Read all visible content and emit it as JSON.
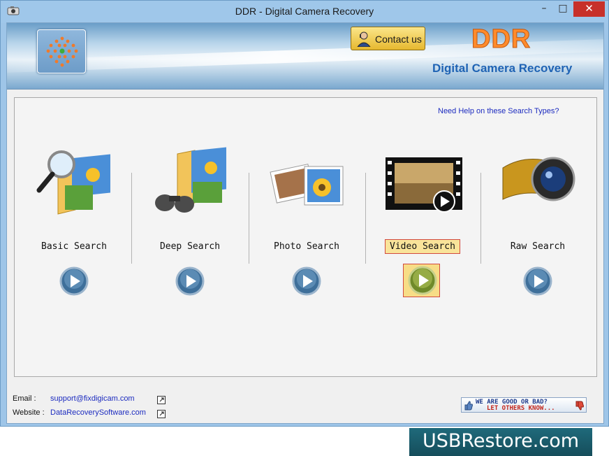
{
  "window": {
    "title": "DDR - Digital Camera Recovery",
    "minimize": "–",
    "maximize": "□",
    "close": "✕"
  },
  "header": {
    "contact_label": "Contact us",
    "brand": "DDR",
    "subtitle": "Digital Camera Recovery"
  },
  "panel": {
    "help_link": "Need Help on these Search Types?",
    "options": [
      {
        "label": "Basic Search",
        "icon": "magnifier-folder-icon",
        "selected": false
      },
      {
        "label": "Deep Search",
        "icon": "binoculars-folder-icon",
        "selected": false
      },
      {
        "label": "Photo Search",
        "icon": "photos-stack-icon",
        "selected": false
      },
      {
        "label": "Video Search",
        "icon": "film-strip-icon",
        "selected": true
      },
      {
        "label": "Raw Search",
        "icon": "camera-lens-film-icon",
        "selected": false
      }
    ]
  },
  "footer": {
    "email_label": "Email :",
    "email_value": "support@fixdigicam.com",
    "website_label": "Website :",
    "website_value": "DataRecoverySoftware.com",
    "rate_line1": "WE ARE GOOD OR BAD?",
    "rate_line2": "LET OTHERS KNOW..."
  },
  "watermark": "USBRestore.com",
  "colors": {
    "accent_orange": "#ff8b2c",
    "subtitle_blue": "#1f63b4",
    "link_blue": "#1c2bbf",
    "selected_fill": "#f9e49a",
    "selected_border": "#d24a3e"
  }
}
